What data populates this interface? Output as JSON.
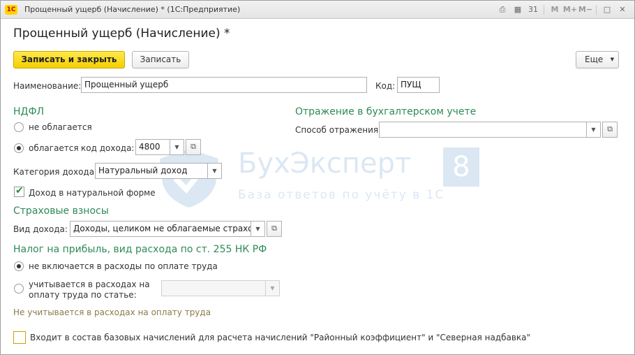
{
  "window": {
    "title": "Прощенный ущерб (Начисление) * (1С:Предприятие)",
    "logo": "1С",
    "icons": [
      "print-icon",
      "calculator-icon",
      "calendar-icon",
      "memory-m-icon",
      "memory-m-plus-icon",
      "memory-m-minus-icon",
      "maximize-icon",
      "close-icon"
    ],
    "icon_texts": {
      "print": "⎙",
      "calc": "▦",
      "cal": "31",
      "m": "M",
      "mplus": "M+",
      "mminus": "M−",
      "max": "□",
      "close": "✕"
    }
  },
  "form": {
    "title": "Прощенный ущерб (Начисление) *",
    "toolbar": {
      "save_close": "Записать и закрыть",
      "save": "Записать",
      "more": "Еще"
    },
    "name_label": "Наименование:",
    "name_value": "Прощенный ущерб",
    "code_label": "Код:",
    "code_value": "ПУЩ"
  },
  "ndfl": {
    "heading": "НДФЛ",
    "option_not_taxed": "не облагается",
    "option_taxed": "облагается",
    "income_code_label": "код дохода:",
    "income_code_value": "4800",
    "category_label": "Категория дохода:",
    "category_value": "Натуральный доход",
    "natural_form_label": "Доход в натуральной форме"
  },
  "accounting": {
    "heading": "Отражение в бухгалтерском учете",
    "method_label": "Способ отражения:",
    "method_value": ""
  },
  "insurance": {
    "heading": "Страховые взносы",
    "income_type_label": "Вид дохода:",
    "income_type_value": "Доходы, целиком не облагаемые страховы"
  },
  "profit_tax": {
    "heading": "Налог на прибыль, вид расхода по ст. 255 НК РФ",
    "option_not_included": "не включается в расходы по оплате труда",
    "option_included_line1": "учитывается в расходах на",
    "option_included_line2": "оплату труда по статье:",
    "article_value": "",
    "note": "Не учитывается в расходах на оплату труда"
  },
  "base_accruals": {
    "label": "Входит в состав базовых начислений для расчета начислений \"Районный коэффициент\" и \"Северная надбавка\""
  },
  "watermark": {
    "title": "БухЭксперт",
    "digit": "8",
    "subtitle": "База ответов по учёту в 1С"
  },
  "colors": {
    "section": "#2e8a57",
    "primary_button": "#f5cf00",
    "note": "#8d7a4a"
  }
}
